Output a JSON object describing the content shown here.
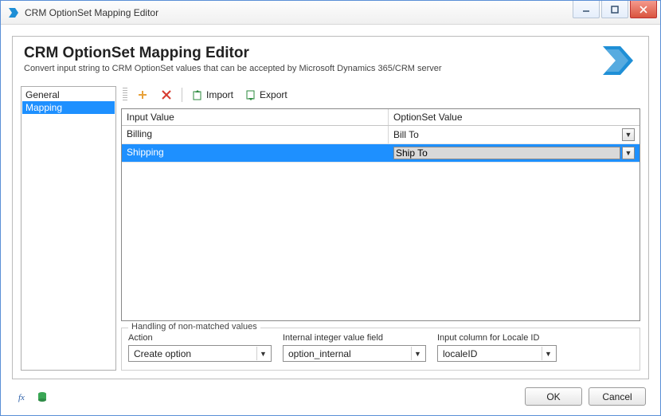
{
  "window": {
    "title": "CRM OptionSet Mapping Editor"
  },
  "header": {
    "title": "CRM OptionSet Mapping Editor",
    "subtitle": "Convert input string to CRM OptionSet values that can be accepted by Microsoft Dynamics 365/CRM server"
  },
  "sidebar": {
    "items": [
      "General",
      "Mapping"
    ],
    "selected": "Mapping"
  },
  "toolbar": {
    "add_tip": "Add",
    "delete_tip": "Delete",
    "import_label": "Import",
    "export_label": "Export"
  },
  "grid": {
    "columns": {
      "input": "Input Value",
      "optionset": "OptionSet Value"
    },
    "rows": [
      {
        "input": "Billing",
        "optionset": "Bill To",
        "selected": false
      },
      {
        "input": "Shipping",
        "optionset": "Ship To",
        "selected": true
      }
    ]
  },
  "nonmatched": {
    "legend": "Handling of non-matched values",
    "action_label": "Action",
    "action_value": "Create option",
    "internal_label": "Internal integer value field",
    "internal_value": "option_internal",
    "locale_label": "Input column for Locale ID",
    "locale_value": "localeID"
  },
  "footer": {
    "ok": "OK",
    "cancel": "Cancel"
  },
  "colors": {
    "accent": "#1e90ff",
    "brand": "#1f8fd6"
  }
}
